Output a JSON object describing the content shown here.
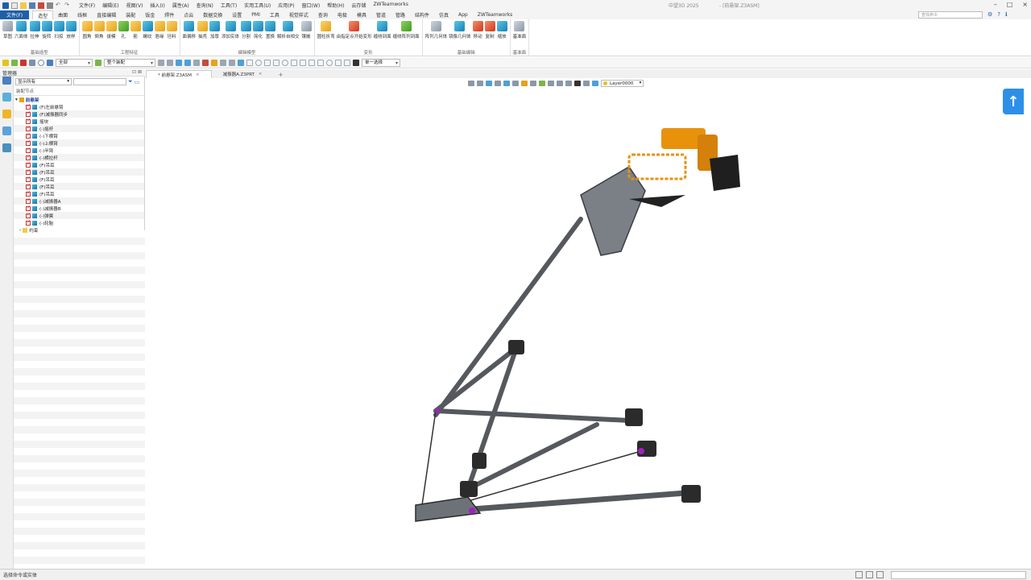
{
  "titlebar": {
    "menus": [
      "文件(F)",
      "编辑(E)",
      "视图(V)",
      "插入(I)",
      "属性(A)",
      "查询(N)",
      "工具(T)",
      "实用工具(U)",
      "应用(P)",
      "窗口(W)",
      "帮助(H)",
      "云存储",
      "ZWTeamworks"
    ],
    "app_title": "中望3D 2025",
    "doc_title": "- [前悬架.Z3ASM]"
  },
  "tabs": {
    "file_label": "文件(F)",
    "items": [
      "造型",
      "曲面",
      "线框",
      "直接编辑",
      "装配",
      "钣金",
      "焊件",
      "点云",
      "数据交换",
      "设置",
      "PMI",
      "工具",
      "视觉样式",
      "查询",
      "电极",
      "模具",
      "管道",
      "管路",
      "结构件",
      "仿真",
      "App",
      "ZWTeamworks"
    ],
    "active": "造型",
    "search_placeholder": "查找命令"
  },
  "ribbon": {
    "groups": [
      {
        "label": "基础造型",
        "buttons": [
          {
            "l": "草图",
            "c": "gray"
          },
          {
            "l": "六面体",
            "c": "teal"
          },
          {
            "l": "拉伸",
            "c": "teal"
          },
          {
            "l": "旋转",
            "c": "teal"
          },
          {
            "l": "扫掠",
            "c": "teal"
          },
          {
            "l": "放样",
            "c": "teal"
          }
        ]
      },
      {
        "label": "工程特征",
        "buttons": [
          {
            "l": "圆角",
            "c": "gold"
          },
          {
            "l": "倒角",
            "c": "gold"
          },
          {
            "l": "拔模",
            "c": "gold"
          },
          {
            "l": "孔",
            "c": "green"
          },
          {
            "l": "筋",
            "c": "gold"
          },
          {
            "l": "螺纹",
            "c": "teal"
          },
          {
            "l": "唇缘",
            "c": "gold"
          },
          {
            "l": "坯料",
            "c": "gold"
          }
        ]
      },
      {
        "label": "编辑模型",
        "buttons": [
          {
            "l": "面偏移",
            "c": "teal"
          },
          {
            "l": "抽壳",
            "c": "gold"
          },
          {
            "l": "加厚",
            "c": "teal"
          },
          {
            "l": "添加实体",
            "c": "teal"
          },
          {
            "l": "分割",
            "c": "teal"
          },
          {
            "l": "简化",
            "c": "teal"
          },
          {
            "l": "置换",
            "c": "teal"
          },
          {
            "l": "解析自相交",
            "c": "teal"
          },
          {
            "l": "镶嵌",
            "c": "gray"
          }
        ]
      },
      {
        "label": "变形",
        "buttons": [
          {
            "l": "圆柱折弯",
            "c": "gold"
          },
          {
            "l": "由指定点开始变形",
            "c": "red"
          },
          {
            "l": "缠绕到面",
            "c": "teal"
          },
          {
            "l": "缠绕阵列到面",
            "c": "green"
          }
        ]
      },
      {
        "label": "基础编辑",
        "buttons": [
          {
            "l": "阵列几何体",
            "c": "gray"
          },
          {
            "l": "镜像几何体",
            "c": "teal"
          },
          {
            "l": "移动",
            "c": "red"
          },
          {
            "l": "复制",
            "c": "red"
          },
          {
            "l": "缩放",
            "c": "teal"
          }
        ]
      },
      {
        "label": "基准面",
        "buttons": [
          {
            "l": "基准面",
            "c": "gray"
          }
        ]
      }
    ]
  },
  "toolbar": {
    "filter_value": "全部",
    "assembly_value": "整个装配",
    "select_mode_value": "单一选择"
  },
  "manager": {
    "title": "管理器",
    "filter_value": "显示所有",
    "tree_header": "装配节点",
    "root": "前悬架",
    "items": [
      "(F)左前悬臂",
      "(F)减振器同步",
      "摇块",
      "(-)摇杆",
      "(-)下横臂",
      "(-)上横臂",
      "(-)半臂",
      "(-)横拉杆",
      "(F)吊耳",
      "(F)吊耳",
      "(F)吊耳",
      "(F)吊耳",
      "(F)吊耳",
      "(-)减振器A",
      "(-)减振器B",
      "(-)弹簧",
      "(-)轮胎"
    ],
    "constraints": "约束"
  },
  "doc_tabs": {
    "items": [
      "* 前悬架.Z3ASM",
      "减振器A.Z3PRT"
    ],
    "active": 0
  },
  "viewport": {
    "layer_value": "Layer0000"
  },
  "status": {
    "text": "选择命令或实体"
  },
  "colors": {
    "accent": "#1f5fa8",
    "shock_orange": "#e8920c",
    "arm_gray": "#55595e",
    "bushing_dark": "#2b2b2b",
    "highlight_purple": "#a020c0"
  }
}
